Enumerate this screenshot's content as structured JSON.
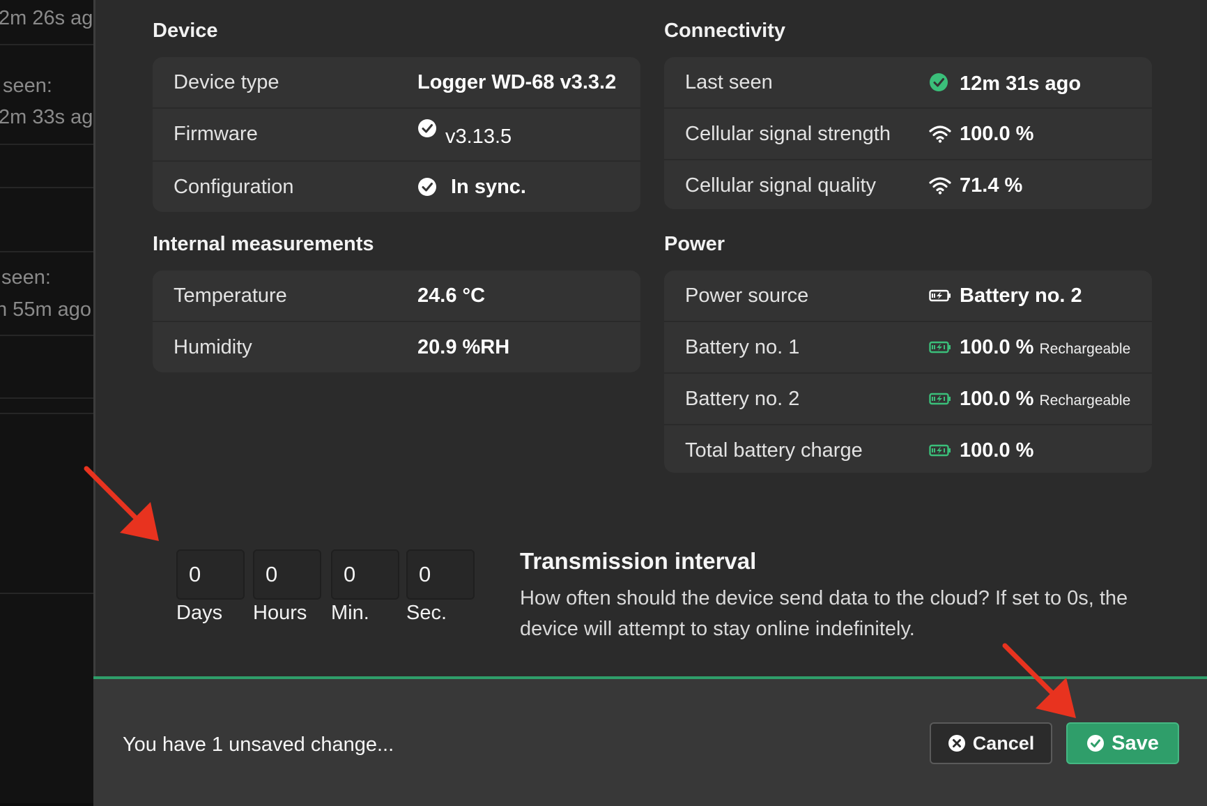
{
  "left_list": {
    "texts": [
      "2m 26s ag",
      "seen:",
      "2m 33s ag",
      "seen:",
      "h 55m ago"
    ]
  },
  "device": {
    "title": "Device",
    "rows": [
      {
        "label": "Device type",
        "value": "Logger WD-68 v3.3.2"
      },
      {
        "label": "Firmware",
        "value": "v3.13.5"
      },
      {
        "label": "Configuration",
        "value": "In sync."
      }
    ]
  },
  "connectivity": {
    "title": "Connectivity",
    "rows": [
      {
        "label": "Last seen",
        "value": "12m 31s ago",
        "icon": "check-circle-icon"
      },
      {
        "label": "Cellular signal strength",
        "value": "100.0 %",
        "icon": "wifi-icon"
      },
      {
        "label": "Cellular signal quality",
        "value": "71.4 %",
        "icon": "wifi-icon"
      }
    ]
  },
  "internal": {
    "title": "Internal measurements",
    "rows": [
      {
        "label": "Temperature",
        "value": "24.6 °C"
      },
      {
        "label": "Humidity",
        "value": "20.9 %RH"
      }
    ]
  },
  "power": {
    "title": "Power",
    "rows": [
      {
        "label": "Power source",
        "value": "Battery no. 2",
        "icon": "battery-icon"
      },
      {
        "label": "Battery no. 1",
        "value": "100.0 %",
        "note": "Rechargeable",
        "icon": "battery-charging-icon"
      },
      {
        "label": "Battery no. 2",
        "value": "100.0 %",
        "note": "Rechargeable",
        "icon": "battery-charging-icon"
      },
      {
        "label": "Total battery charge",
        "value": "100.0 %",
        "icon": "battery-charging-icon"
      }
    ]
  },
  "interval": {
    "title": "Transmission interval",
    "description": "How often should the device send data to the cloud? If set to 0s, the device will attempt to stay online indefinitely.",
    "fields": [
      {
        "value": "0",
        "unit": "Days"
      },
      {
        "value": "0",
        "unit": "Hours"
      },
      {
        "value": "0",
        "unit": "Min."
      },
      {
        "value": "0",
        "unit": "Sec."
      }
    ]
  },
  "footer": {
    "unsaved_text": "You have 1 unsaved change...",
    "cancel_label": "Cancel",
    "save_label": "Save"
  },
  "colors": {
    "accent_green": "#2f9e6a",
    "annotation_red": "#e8331f",
    "background": "#2b2b2b"
  }
}
